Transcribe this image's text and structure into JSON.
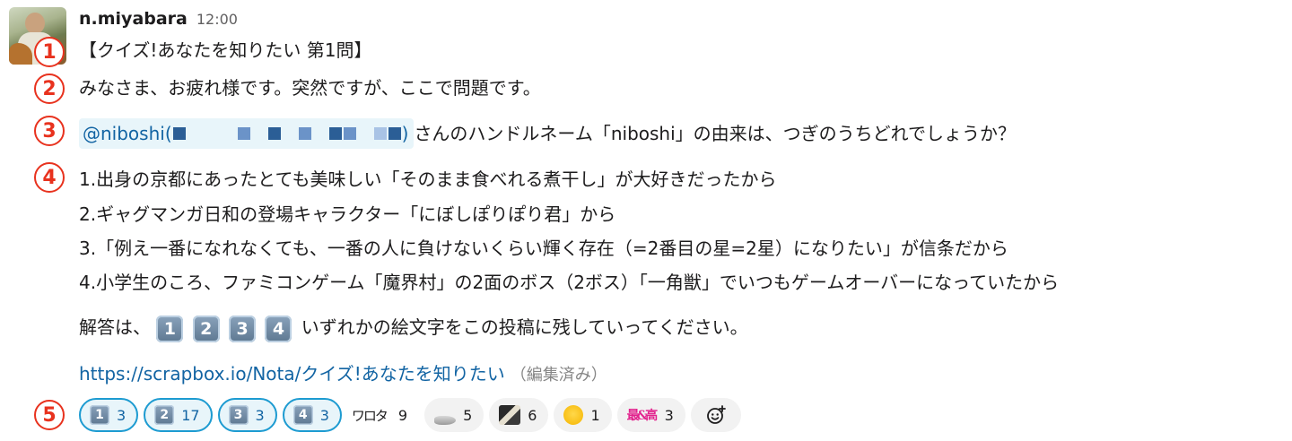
{
  "message": {
    "username": "n.miyabara",
    "time": "12:00",
    "title": "【クイズ!あなたを知りたい 第1問】",
    "greeting": "みなさま、お疲れ様です。突然ですが、ここで問題です。",
    "mention_handle": "@niboshi(",
    "mention_close": ")",
    "question_text": "さんのハンドルネーム「niboshi」の由来は、つぎのうちどれでしょうか？",
    "options": [
      "1.出身の京都にあったとても美味しい「そのまま食べれる煮干し」が大好きだったから",
      "2.ギャグマンガ日和の登場キャラクター「にぼしぽりぽり君」から",
      "3.「例え一番になれなくても、一番の人に負けないくらい輝く存在（=2番目の星=2星）になりたい」が信条だから",
      "4.小学生のころ、ファミコンゲーム「魔界村」の2面のボス（2ボス）「一角獣」でいつもゲームオーバーになっていたから"
    ],
    "answer_prefix": "解答は、",
    "answer_keys": [
      "1",
      "2",
      "3",
      "4"
    ],
    "answer_suffix": "いずれかの絵文字をこの投稿に残していってください。",
    "link_text": "https://scrapbox.io/Nota/クイズ!あなたを知りたい",
    "edited_label": "（編集済み）"
  },
  "markers": [
    "1",
    "2",
    "3",
    "4",
    "5"
  ],
  "reactions": [
    {
      "emoji": "keycap-1",
      "label": "1",
      "count": "3",
      "mine": true
    },
    {
      "emoji": "keycap-2",
      "label": "2",
      "count": "17",
      "mine": true
    },
    {
      "emoji": "keycap-3",
      "label": "3",
      "count": "3",
      "mine": true
    },
    {
      "emoji": "keycap-4",
      "label": "4",
      "count": "3",
      "mine": true
    },
    {
      "emoji": "custom-kanji-emoji",
      "label": "ワロタ",
      "count": "9",
      "mine": false
    },
    {
      "emoji": "dried-fish-emoji",
      "count": "5",
      "mine": false
    },
    {
      "emoji": "custom-photo-emoji",
      "count": "6",
      "mine": false
    },
    {
      "emoji": "joy-emoji",
      "count": "1",
      "mine": false
    },
    {
      "emoji": "custom-pink-text-emoji",
      "label": "最&高",
      "count": "3",
      "mine": false
    }
  ],
  "colors": {
    "marker": "#e8321e",
    "link": "#1264a3",
    "mention_bg": "#e8f5fa",
    "reaction_mine_border": "#1d9bd1"
  }
}
